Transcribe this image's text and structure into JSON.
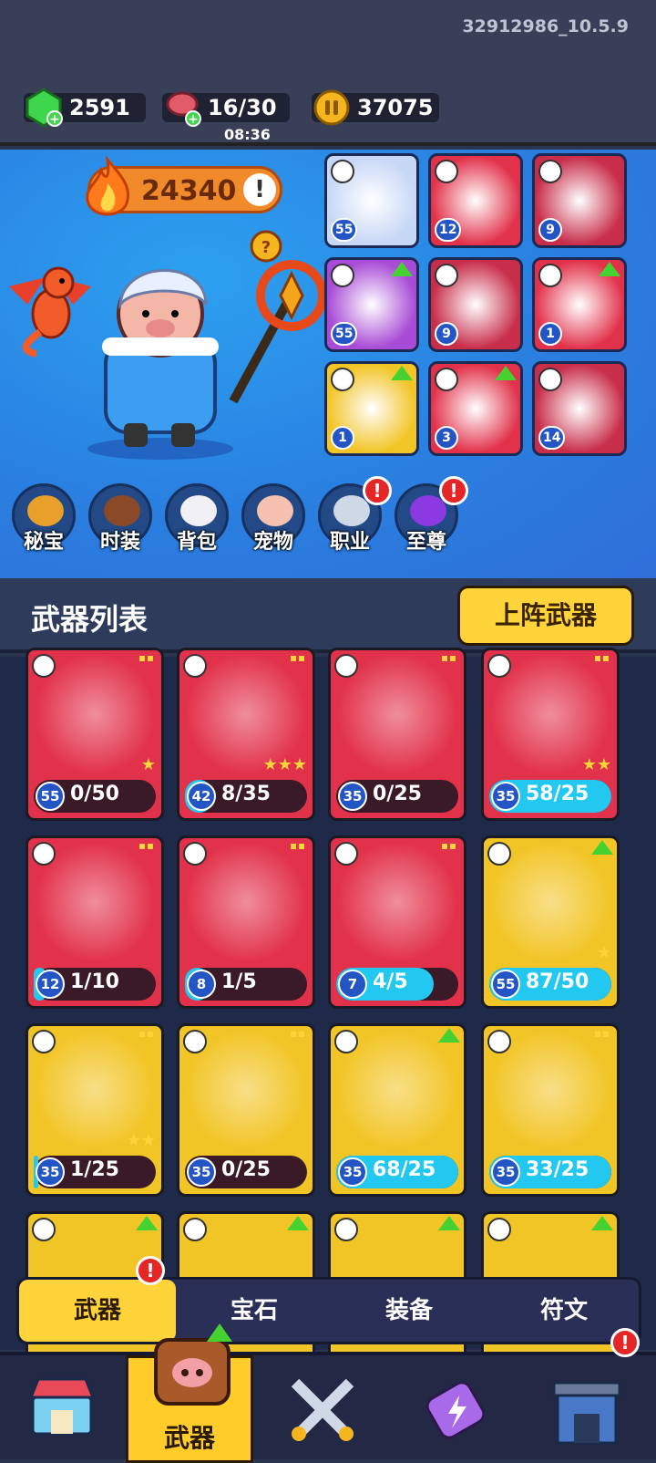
{
  "build": "32912986_10.5.9",
  "resources": {
    "gems": "2591",
    "meat": "16/30",
    "meat_timer": "08:36",
    "coins": "37075"
  },
  "hero": {
    "power": "24340"
  },
  "equipped": [
    {
      "level": "55",
      "color": "#c7d7f6",
      "upgrade": false
    },
    {
      "level": "12",
      "color": "#e2324b",
      "upgrade": false
    },
    {
      "level": "9",
      "color": "#c82d4a",
      "upgrade": false
    },
    {
      "level": "55",
      "color": "#a84bd6",
      "upgrade": true
    },
    {
      "level": "9",
      "color": "#c82d4a",
      "upgrade": false
    },
    {
      "level": "1",
      "color": "#e2324b",
      "upgrade": true
    },
    {
      "level": "1",
      "color": "#f2c526",
      "upgrade": true
    },
    {
      "level": "3",
      "color": "#e2324b",
      "upgrade": true
    },
    {
      "level": "14",
      "color": "#c82d4a",
      "upgrade": false
    }
  ],
  "side_menu": [
    {
      "label": "秘宝",
      "badge": false
    },
    {
      "label": "时装",
      "badge": false
    },
    {
      "label": "背包",
      "badge": false
    },
    {
      "label": "宠物",
      "badge": false
    },
    {
      "label": "职业",
      "badge": true
    },
    {
      "label": "至尊",
      "badge": true
    }
  ],
  "weapon_list": {
    "title": "武器列表",
    "deploy_button": "上阵武器"
  },
  "weapons": [
    {
      "level": "55",
      "count": "0/50",
      "progress": 0,
      "color": "#e2324b",
      "stars": "★",
      "upgrade": false
    },
    {
      "level": "42",
      "count": "8/35",
      "progress": 0.23,
      "color": "#e2324b",
      "stars": "★★★",
      "upgrade": false
    },
    {
      "level": "35",
      "count": "0/25",
      "progress": 0,
      "color": "#e2324b",
      "stars": "",
      "upgrade": false
    },
    {
      "level": "35",
      "count": "58/25",
      "progress": 1,
      "color": "#e2324b",
      "stars": "★★",
      "upgrade": false
    },
    {
      "level": "12",
      "count": "1/10",
      "progress": 0.1,
      "color": "#e2324b",
      "stars": "",
      "upgrade": false
    },
    {
      "level": "8",
      "count": "1/5",
      "progress": 0.2,
      "color": "#e2324b",
      "stars": "",
      "upgrade": false
    },
    {
      "level": "7",
      "count": "4/5",
      "progress": 0.8,
      "color": "#e2324b",
      "stars": "",
      "upgrade": false
    },
    {
      "level": "55",
      "count": "87/50",
      "progress": 1,
      "color": "#f2c526",
      "stars": "★",
      "upgrade": true
    },
    {
      "level": "35",
      "count": "1/25",
      "progress": 0.04,
      "color": "#f2c526",
      "stars": "★★",
      "upgrade": false
    },
    {
      "level": "35",
      "count": "0/25",
      "progress": 0,
      "color": "#f2c526",
      "stars": "",
      "upgrade": false
    },
    {
      "level": "35",
      "count": "68/25",
      "progress": 1,
      "color": "#f2c526",
      "stars": "",
      "upgrade": true
    },
    {
      "level": "35",
      "count": "33/25",
      "progress": 1,
      "color": "#f2c526",
      "stars": "",
      "upgrade": false
    }
  ],
  "tabs": [
    {
      "label": "武器",
      "active": true,
      "badge": true
    },
    {
      "label": "宝石",
      "active": false,
      "badge": false
    },
    {
      "label": "装备",
      "active": false,
      "badge": false
    },
    {
      "label": "符文",
      "active": false,
      "badge": false
    }
  ],
  "nav": {
    "active_label": "武器"
  }
}
